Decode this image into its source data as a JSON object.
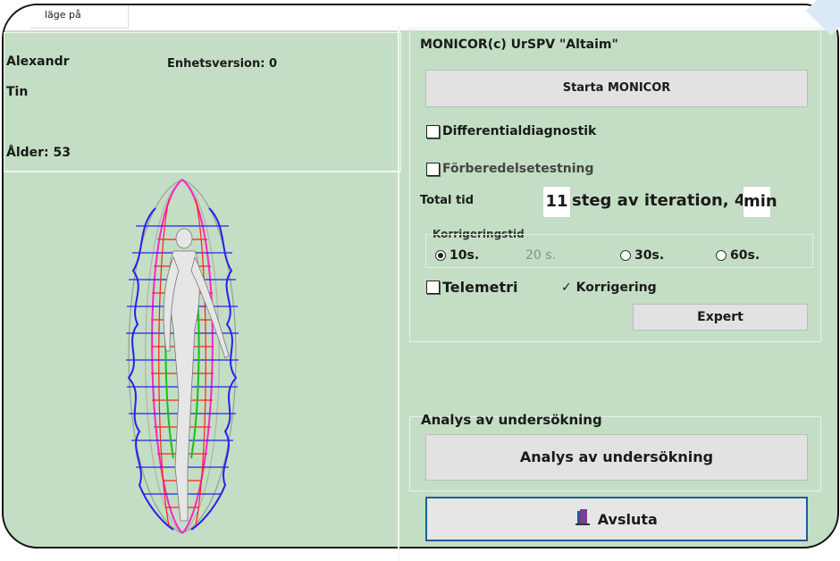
{
  "window": {
    "tab_label": "läge på"
  },
  "patient": {
    "first_name": "Alexandr",
    "last_name": "Tin",
    "device_version": "Enhetsversion: 0",
    "age": "Ålder: 53"
  },
  "app": {
    "title": "MONICOR(c) UrSPV \"Altaim\"",
    "start_button": "Starta MONICOR",
    "differential_label": "Differentialdiagnostik",
    "preparation_label": "Förberedelsetestning",
    "total_time_label": "Total tid",
    "total_time_steps": "11",
    "total_time_text": "steg av iteration, 4",
    "total_time_unit": "min",
    "correction_time_group": "Korrigeringstid",
    "correction_options": [
      {
        "label": "10s.",
        "selected": true
      },
      {
        "label": "20 s.",
        "selected": false
      },
      {
        "label": "30s.",
        "selected": false
      },
      {
        "label": "60s.",
        "selected": false
      }
    ],
    "telemetry_label": "Telemetri",
    "correction_check": "✓ Korrigering",
    "expert_button": "Expert"
  },
  "analysis": {
    "group_label": "Analys av undersökning",
    "button_label": "Analys av undersökning"
  },
  "exit": {
    "button_label": "Avsluta",
    "icon": "door-exit-icon"
  },
  "colors": {
    "background": "#c3dec4",
    "button": "#e2e2e2",
    "exit_border": "#1a5f98",
    "mesh_red": "#ff2020",
    "mesh_blue": "#2222ee",
    "mesh_magenta": "#ff22cc",
    "mesh_green": "#1dbb1d"
  }
}
